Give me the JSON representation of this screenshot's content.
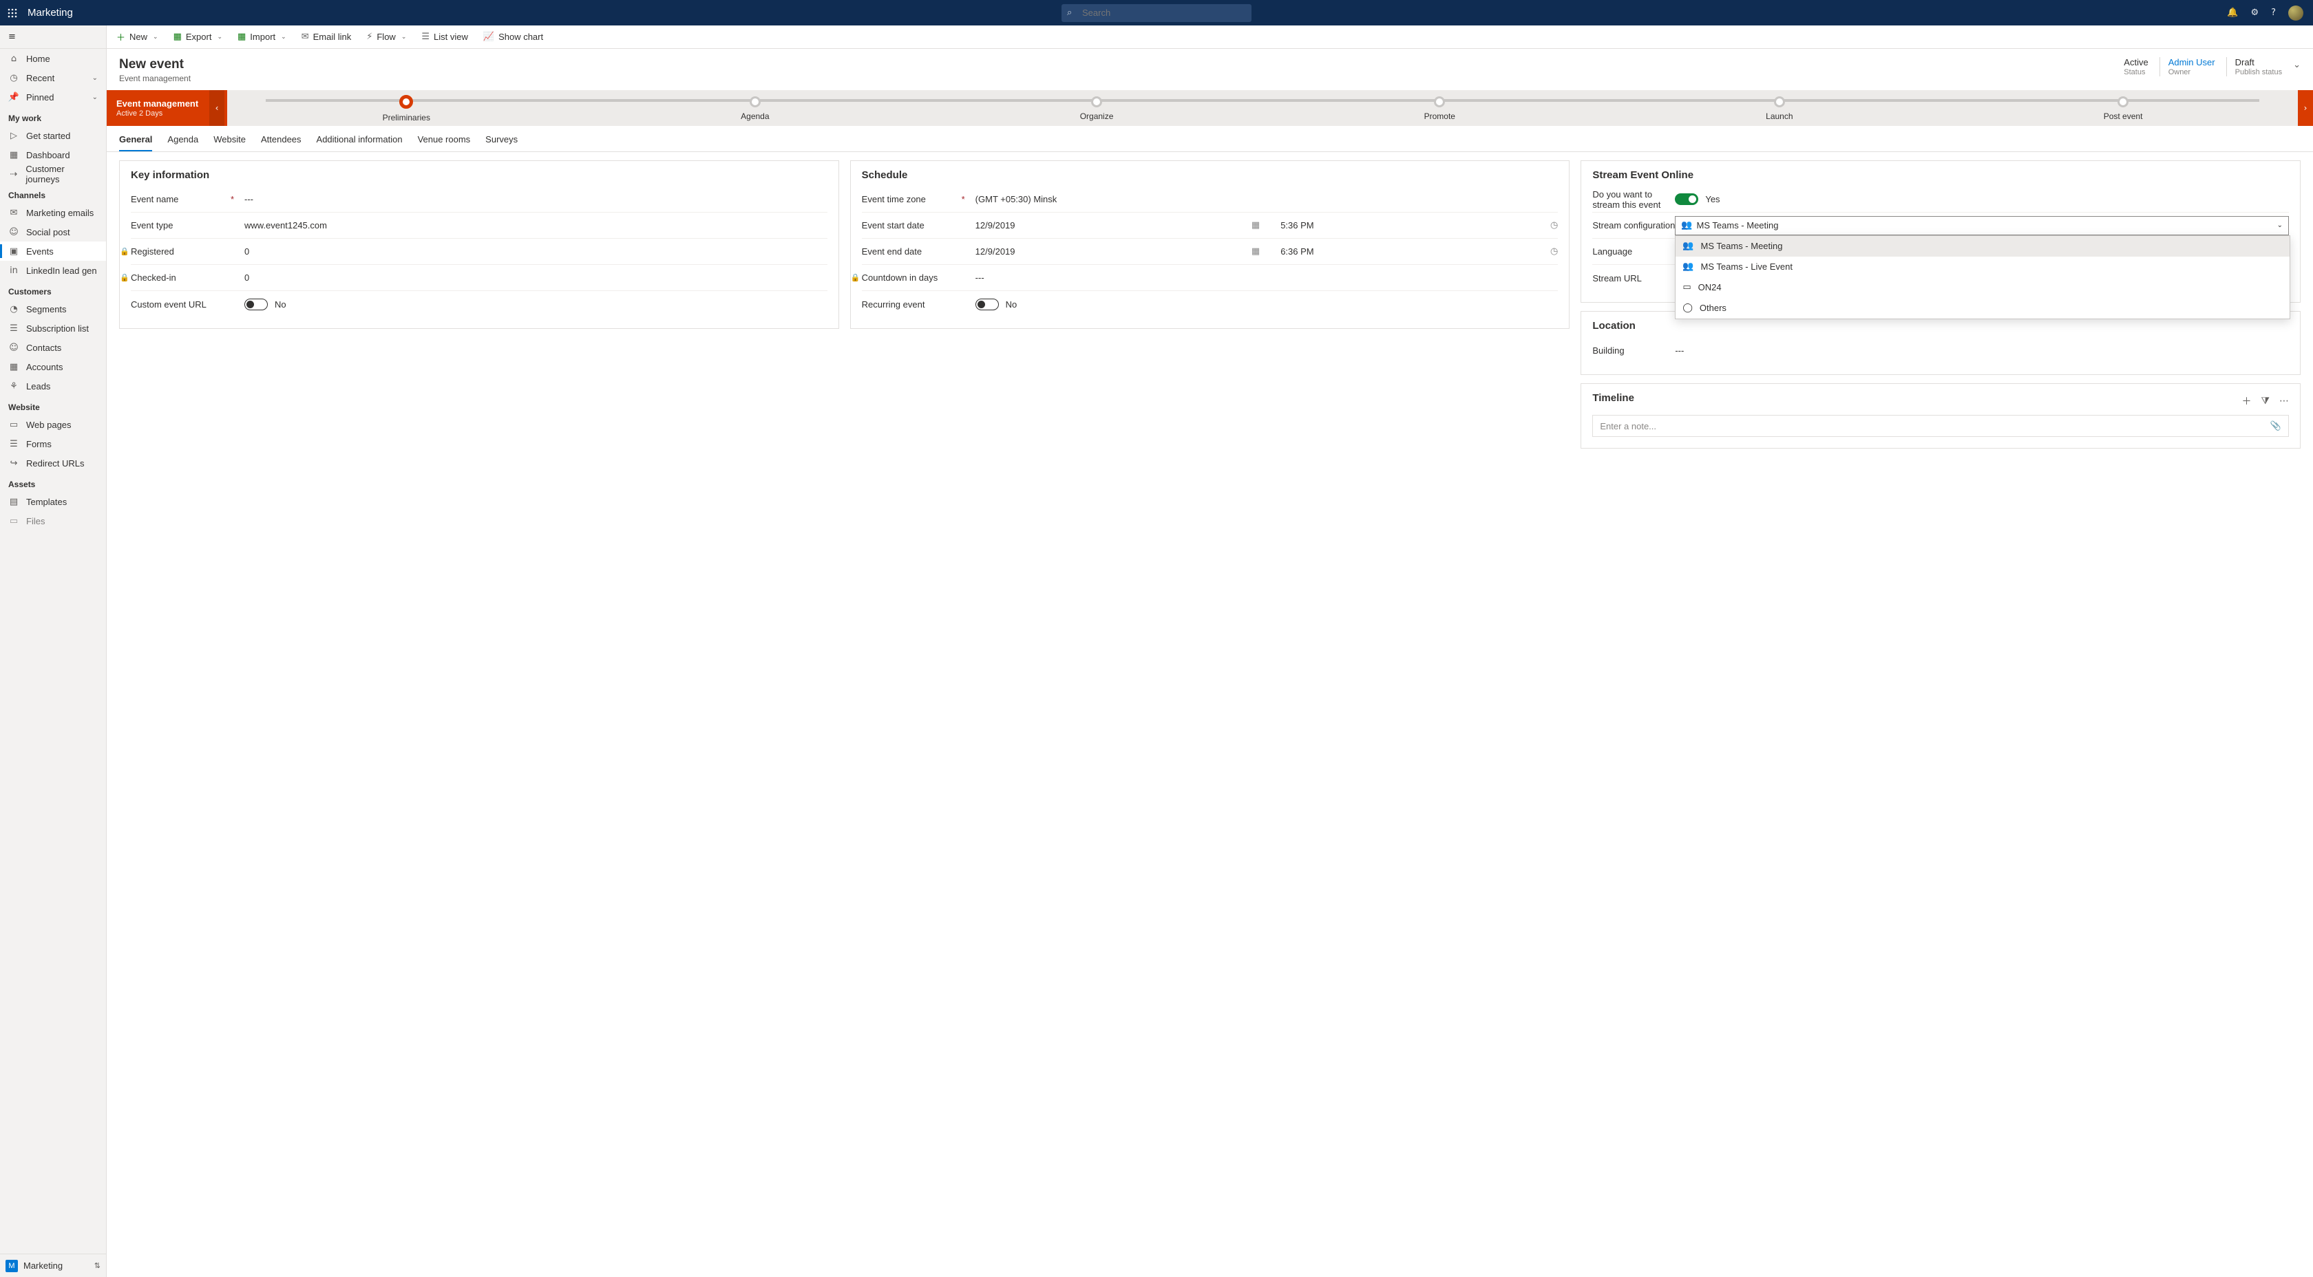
{
  "top": {
    "app": "Marketing",
    "search_ph": "Search"
  },
  "sidebar": {
    "home": "Home",
    "recent": "Recent",
    "pinned": "Pinned",
    "sections": [
      {
        "title": "My work",
        "items": [
          "Get started",
          "Dashboard",
          "Customer journeys"
        ]
      },
      {
        "title": "Channels",
        "items": [
          "Marketing emails",
          "Social post",
          "Events",
          "LinkedIn lead gen"
        ]
      },
      {
        "title": "Customers",
        "items": [
          "Segments",
          "Subscription list",
          "Contacts",
          "Accounts",
          "Leads"
        ]
      },
      {
        "title": "Website",
        "items": [
          "Web pages",
          "Forms",
          "Redirect URLs"
        ]
      },
      {
        "title": "Assets",
        "items": [
          "Templates",
          "Files"
        ]
      }
    ],
    "foot_letter": "M",
    "foot_label": "Marketing"
  },
  "cmd": {
    "new": "New",
    "export": "Export",
    "import": "Import",
    "emaillink": "Email link",
    "flow": "Flow",
    "listview": "List view",
    "showchart": "Show chart"
  },
  "head": {
    "title": "New event",
    "sub": "Event management",
    "status_v": "Active",
    "status_l": "Status",
    "owner_v": "Admin User",
    "owner_l": "Owner",
    "pub_v": "Draft",
    "pub_l": "Publish status"
  },
  "stage": {
    "cur_title": "Event management",
    "cur_sub": "Active 2 Days",
    "nodes": [
      "Preliminaries",
      "Agenda",
      "Organize",
      "Promote",
      "Launch",
      "Post event"
    ]
  },
  "tabs": [
    "General",
    "Agenda",
    "Website",
    "Attendees",
    "Additional information",
    "Venue rooms",
    "Surveys"
  ],
  "key": {
    "card_title": "Key information",
    "event_name_l": "Event name",
    "event_name_v": "---",
    "event_type_l": "Event type",
    "event_type_v": "www.event1245.com",
    "registered_l": "Registered",
    "registered_v": "0",
    "checkedin_l": "Checked-in",
    "checkedin_v": "0",
    "custom_url_l": "Custom event URL",
    "custom_url_v": "No"
  },
  "sched": {
    "card_title": "Schedule",
    "tz_l": "Event time zone",
    "tz_v": "(GMT +05:30) Minsk",
    "start_l": "Event start date",
    "start_d": "12/9/2019",
    "start_t": "5:36 PM",
    "end_l": "Event end date",
    "end_d": "12/9/2019",
    "end_t": "6:36 PM",
    "countdown_l": "Countdown in days",
    "countdown_v": "---",
    "recur_l": "Recurring event",
    "recur_v": "No"
  },
  "stream": {
    "card_title": "Stream Event Online",
    "q_l": "Do you want to stream this event",
    "q_v": "Yes",
    "config_l": "Stream configuration",
    "config_v": "MS Teams - Meeting",
    "options": [
      "MS Teams - Meeting",
      "MS Teams - Live Event",
      "ON24",
      "Others"
    ],
    "lang_l": "Language",
    "url_l": "Stream URL"
  },
  "loc": {
    "card_title": "Location",
    "building_l": "Building",
    "building_v": "---"
  },
  "tl": {
    "card_title": "Timeline",
    "note_ph": "Enter a note..."
  }
}
